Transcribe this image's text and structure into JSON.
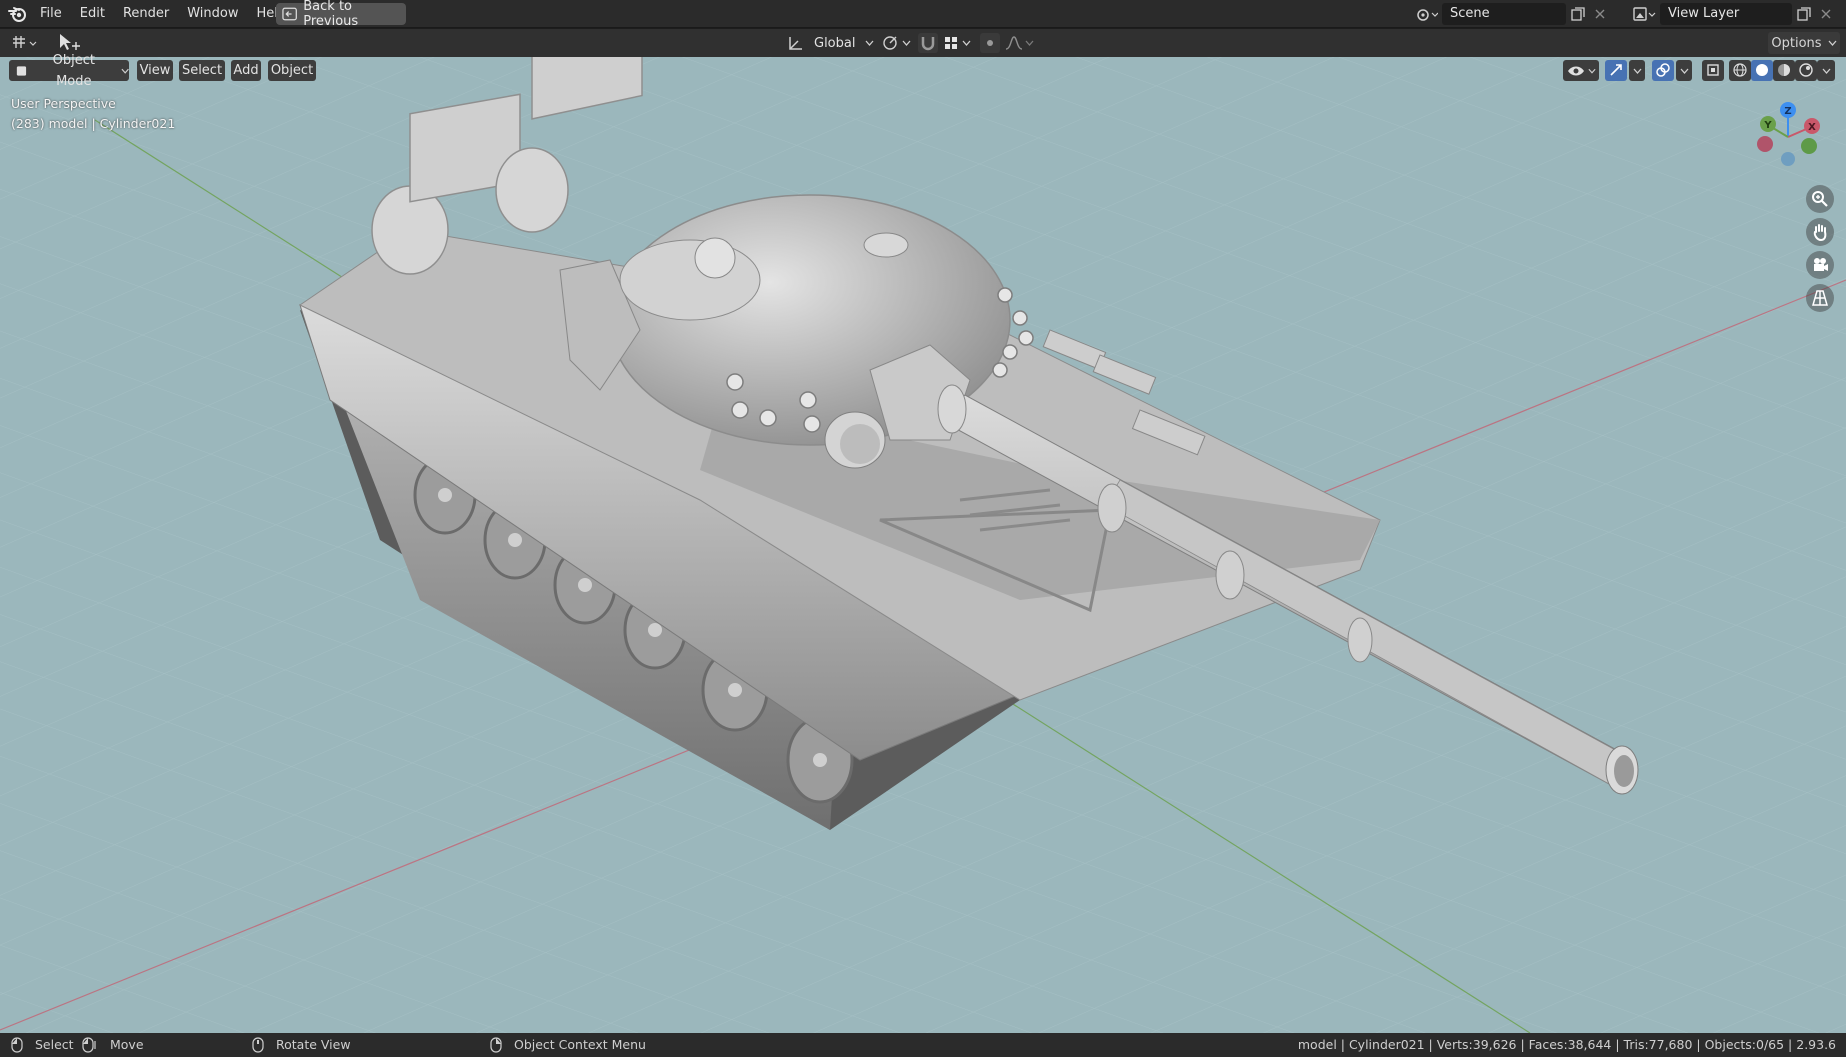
{
  "menu": {
    "file": "File",
    "edit": "Edit",
    "render": "Render",
    "window": "Window",
    "help": "Help",
    "back_to_previous": "Back to Previous"
  },
  "scene": {
    "name": "Scene"
  },
  "view_layer": {
    "name": "View Layer"
  },
  "toolbar": {
    "transform_orientation": "Global",
    "options": "Options"
  },
  "header": {
    "mode": "Object Mode",
    "view": "View",
    "select": "Select",
    "add": "Add",
    "object": "Object"
  },
  "viewport": {
    "perspective": "User Perspective",
    "active_object": "(283) model | Cylinder021"
  },
  "gizmo": {
    "z": "Z",
    "y": "Y",
    "x": "X"
  },
  "status": {
    "select": "Select",
    "move": "Move",
    "rotate_view": "Rotate View",
    "context_menu": "Object Context Menu",
    "stats": "model | Cylinder021 | Verts:39,626 | Faces:38,644 | Tris:77,680 | Objects:0/65 | 2.93.6"
  },
  "colors": {
    "viewport_bg": "#9bb7bc",
    "axis_x": "#c9586a",
    "axis_y": "#6aa04a",
    "axis_z": "#3d8ff0"
  }
}
